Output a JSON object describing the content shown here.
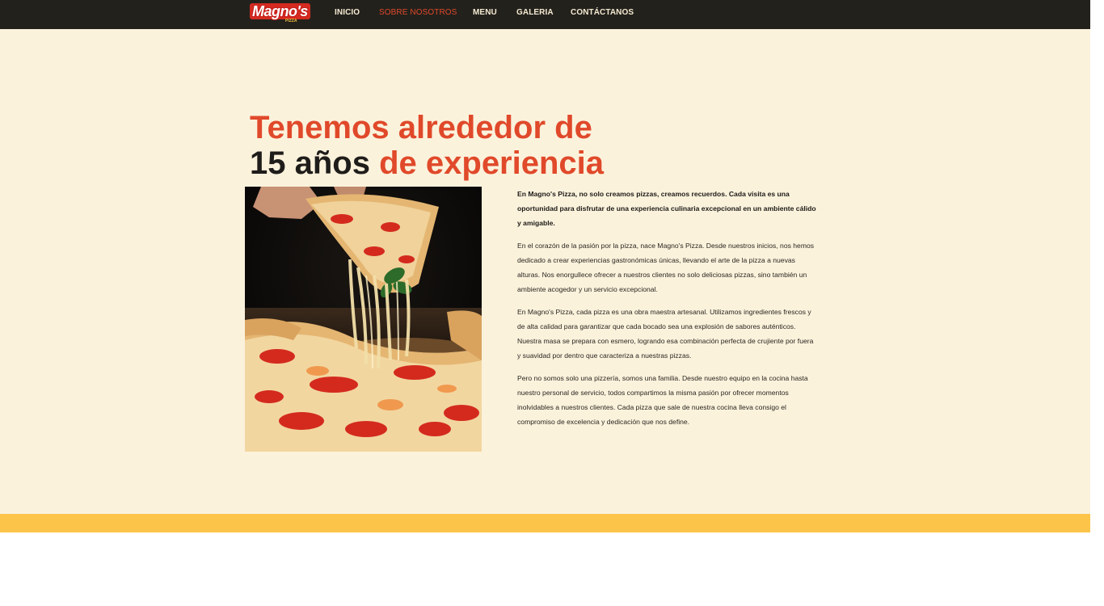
{
  "nav": {
    "logo_text": "Magno's",
    "logo_sub": "PIZZA",
    "items": [
      {
        "label": "INICIO"
      },
      {
        "label": "SOBRE NOSOTROS"
      },
      {
        "label": "MENU"
      },
      {
        "label": "GALERIA"
      },
      {
        "label": "CONTÁCTANOS"
      }
    ],
    "active_index": 1
  },
  "about": {
    "heading_line1": "Tenemos alrededor de",
    "heading_years": "15 años",
    "heading_rest": "de experiencia",
    "image_alt": "pizza-slice-photo",
    "paragraphs": [
      "En Magno's Pizza, no solo creamos pizzas, creamos recuerdos. Cada visita es una oportunidad para disfrutar de una experiencia culinaria excepcional en un ambiente cálido y amigable.",
      "En el corazón de la pasión por la pizza, nace Magno's Pizza. Desde nuestros inicios, nos hemos dedicado a crear experiencias gastronómicas únicas, llevando el arte de la pizza a nuevas alturas. Nos enorgullece ofrecer a nuestros clientes no solo deliciosas pizzas, sino también un ambiente acogedor y un servicio excepcional.",
      "En Magno's Pizza, cada pizza es una obra maestra artesanal. Utilizamos ingredientes frescos y de alta calidad para garantizar que cada bocado sea una explosión de sabores auténticos. Nuestra masa se prepara con esmero, logrando esa combinación perfecta de crujiente por fuera y suavidad por dentro que caracteriza a nuestras pizzas.",
      "Pero no somos solo una pizzería, somos una familia. Desde nuestro equipo en la cocina hasta nuestro personal de servicio, todos compartimos la misma pasión por ofrecer momentos inolvidables a nuestros clientes. Cada pizza que sale de nuestra cocina lleva consigo el compromiso de excelencia y dedicación que nos define."
    ]
  },
  "colors": {
    "nav_bg": "#23211c",
    "accent": "#e0492a",
    "section_bg": "#fbf2dc",
    "band": "#fcc54a"
  }
}
